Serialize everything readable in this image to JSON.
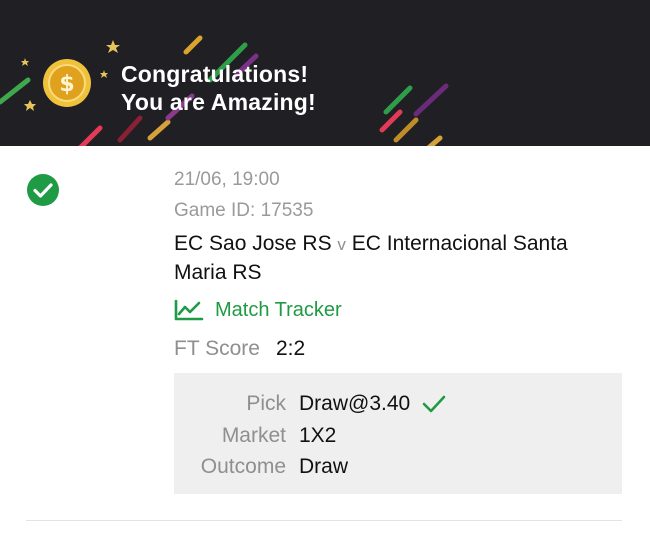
{
  "banner": {
    "line1": "Congratulations!",
    "line2": "You are Amazing!",
    "coin_icon": "dollar-coin-icon"
  },
  "bet": {
    "status_icon": "check-circle-icon",
    "datetime": "21/06, 19:00",
    "game_id": "Game ID: 17535",
    "home_team": "EC Sao Jose RS",
    "vs": "v",
    "away_team": "EC Internacional Santa Maria RS",
    "tracker_icon": "line-chart-icon",
    "tracker_label": "Match Tracker",
    "ft_score_label": "FT Score",
    "ft_score_value": "2:2"
  },
  "pick": {
    "pick_label": "Pick",
    "pick_value": "Draw@3.40",
    "pick_status_icon": "checkmark-icon",
    "market_label": "Market",
    "market_value": "1X2",
    "outcome_label": "Outcome",
    "outcome_value": "Draw"
  },
  "colors": {
    "banner_bg": "#1f1f24",
    "success_green": "#1f9a45",
    "muted_text": "#9a9a9a",
    "pick_box_bg": "#efefef"
  }
}
